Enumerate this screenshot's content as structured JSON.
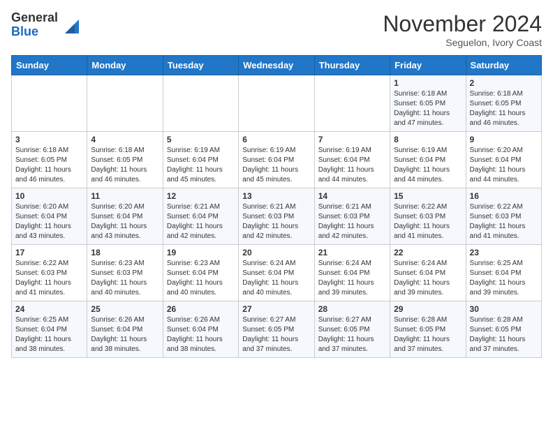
{
  "logo": {
    "general": "General",
    "blue": "Blue"
  },
  "header": {
    "month": "November 2024",
    "location": "Seguelon, Ivory Coast"
  },
  "weekdays": [
    "Sunday",
    "Monday",
    "Tuesday",
    "Wednesday",
    "Thursday",
    "Friday",
    "Saturday"
  ],
  "weeks": [
    [
      {
        "day": "",
        "info": ""
      },
      {
        "day": "",
        "info": ""
      },
      {
        "day": "",
        "info": ""
      },
      {
        "day": "",
        "info": ""
      },
      {
        "day": "",
        "info": ""
      },
      {
        "day": "1",
        "info": "Sunrise: 6:18 AM\nSunset: 6:05 PM\nDaylight: 11 hours and 47 minutes."
      },
      {
        "day": "2",
        "info": "Sunrise: 6:18 AM\nSunset: 6:05 PM\nDaylight: 11 hours and 46 minutes."
      }
    ],
    [
      {
        "day": "3",
        "info": "Sunrise: 6:18 AM\nSunset: 6:05 PM\nDaylight: 11 hours and 46 minutes."
      },
      {
        "day": "4",
        "info": "Sunrise: 6:18 AM\nSunset: 6:05 PM\nDaylight: 11 hours and 46 minutes."
      },
      {
        "day": "5",
        "info": "Sunrise: 6:19 AM\nSunset: 6:04 PM\nDaylight: 11 hours and 45 minutes."
      },
      {
        "day": "6",
        "info": "Sunrise: 6:19 AM\nSunset: 6:04 PM\nDaylight: 11 hours and 45 minutes."
      },
      {
        "day": "7",
        "info": "Sunrise: 6:19 AM\nSunset: 6:04 PM\nDaylight: 11 hours and 44 minutes."
      },
      {
        "day": "8",
        "info": "Sunrise: 6:19 AM\nSunset: 6:04 PM\nDaylight: 11 hours and 44 minutes."
      },
      {
        "day": "9",
        "info": "Sunrise: 6:20 AM\nSunset: 6:04 PM\nDaylight: 11 hours and 44 minutes."
      }
    ],
    [
      {
        "day": "10",
        "info": "Sunrise: 6:20 AM\nSunset: 6:04 PM\nDaylight: 11 hours and 43 minutes."
      },
      {
        "day": "11",
        "info": "Sunrise: 6:20 AM\nSunset: 6:04 PM\nDaylight: 11 hours and 43 minutes."
      },
      {
        "day": "12",
        "info": "Sunrise: 6:21 AM\nSunset: 6:04 PM\nDaylight: 11 hours and 42 minutes."
      },
      {
        "day": "13",
        "info": "Sunrise: 6:21 AM\nSunset: 6:03 PM\nDaylight: 11 hours and 42 minutes."
      },
      {
        "day": "14",
        "info": "Sunrise: 6:21 AM\nSunset: 6:03 PM\nDaylight: 11 hours and 42 minutes."
      },
      {
        "day": "15",
        "info": "Sunrise: 6:22 AM\nSunset: 6:03 PM\nDaylight: 11 hours and 41 minutes."
      },
      {
        "day": "16",
        "info": "Sunrise: 6:22 AM\nSunset: 6:03 PM\nDaylight: 11 hours and 41 minutes."
      }
    ],
    [
      {
        "day": "17",
        "info": "Sunrise: 6:22 AM\nSunset: 6:03 PM\nDaylight: 11 hours and 41 minutes."
      },
      {
        "day": "18",
        "info": "Sunrise: 6:23 AM\nSunset: 6:03 PM\nDaylight: 11 hours and 40 minutes."
      },
      {
        "day": "19",
        "info": "Sunrise: 6:23 AM\nSunset: 6:04 PM\nDaylight: 11 hours and 40 minutes."
      },
      {
        "day": "20",
        "info": "Sunrise: 6:24 AM\nSunset: 6:04 PM\nDaylight: 11 hours and 40 minutes."
      },
      {
        "day": "21",
        "info": "Sunrise: 6:24 AM\nSunset: 6:04 PM\nDaylight: 11 hours and 39 minutes."
      },
      {
        "day": "22",
        "info": "Sunrise: 6:24 AM\nSunset: 6:04 PM\nDaylight: 11 hours and 39 minutes."
      },
      {
        "day": "23",
        "info": "Sunrise: 6:25 AM\nSunset: 6:04 PM\nDaylight: 11 hours and 39 minutes."
      }
    ],
    [
      {
        "day": "24",
        "info": "Sunrise: 6:25 AM\nSunset: 6:04 PM\nDaylight: 11 hours and 38 minutes."
      },
      {
        "day": "25",
        "info": "Sunrise: 6:26 AM\nSunset: 6:04 PM\nDaylight: 11 hours and 38 minutes."
      },
      {
        "day": "26",
        "info": "Sunrise: 6:26 AM\nSunset: 6:04 PM\nDaylight: 11 hours and 38 minutes."
      },
      {
        "day": "27",
        "info": "Sunrise: 6:27 AM\nSunset: 6:05 PM\nDaylight: 11 hours and 37 minutes."
      },
      {
        "day": "28",
        "info": "Sunrise: 6:27 AM\nSunset: 6:05 PM\nDaylight: 11 hours and 37 minutes."
      },
      {
        "day": "29",
        "info": "Sunrise: 6:28 AM\nSunset: 6:05 PM\nDaylight: 11 hours and 37 minutes."
      },
      {
        "day": "30",
        "info": "Sunrise: 6:28 AM\nSunset: 6:05 PM\nDaylight: 11 hours and 37 minutes."
      }
    ]
  ]
}
